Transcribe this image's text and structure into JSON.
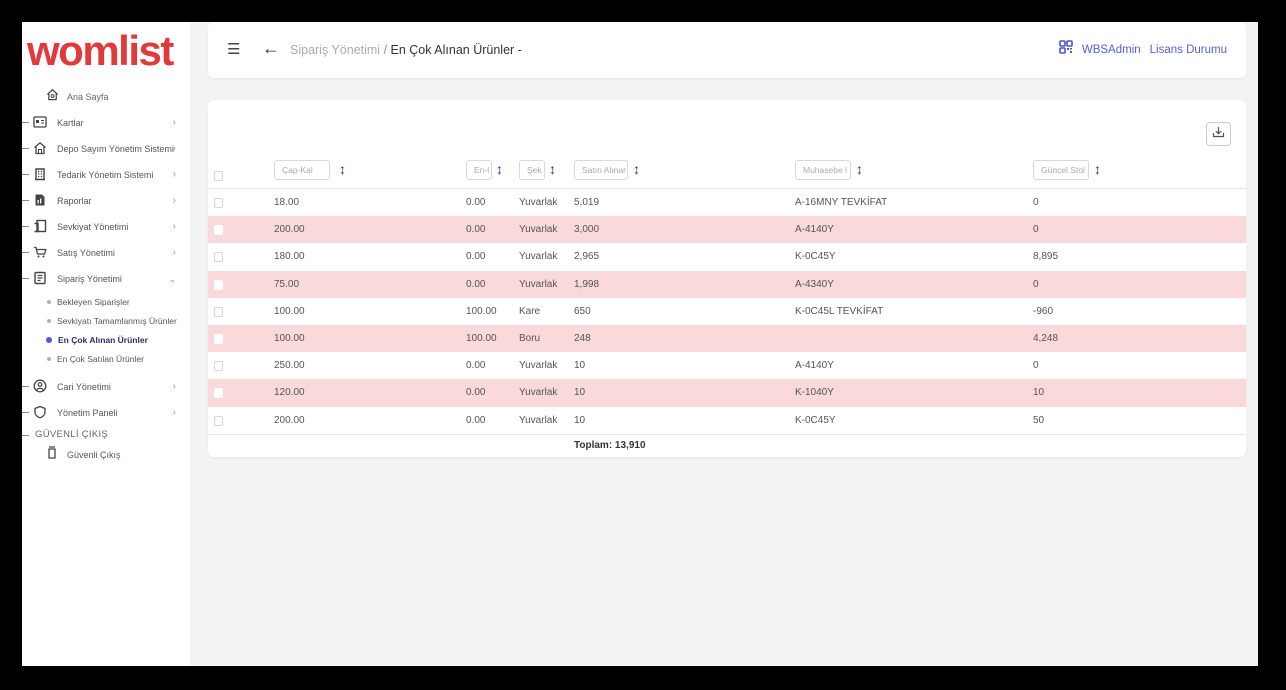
{
  "app": {
    "logo": "womlist",
    "accent": "#e23a3a",
    "link_color": "#5560d8"
  },
  "sidebar": {
    "home_label": "Ana Sayfa",
    "items": [
      {
        "label": "Kartlar",
        "icon": "card-icon"
      },
      {
        "label": "Depo Sayım Yönetim Sistemi",
        "icon": "warehouse-icon"
      },
      {
        "label": "Tedarik Yönetim Sistemi",
        "icon": "building-icon"
      },
      {
        "label": "Raporlar",
        "icon": "report-icon"
      },
      {
        "label": "Sevkiyat Yönetimi",
        "icon": "shipment-icon"
      },
      {
        "label": "Satış Yönetimi",
        "icon": "cart-icon"
      },
      {
        "label": "Sipariş Yönetimi",
        "icon": "order-icon"
      }
    ],
    "sub_items": [
      {
        "label": "Bekleyen Siparişler",
        "active": false
      },
      {
        "label": "Sevkiyatı Tamamlanmış Ürünler",
        "active": false
      },
      {
        "label": "En Çok Alınan Ürünler",
        "active": true
      },
      {
        "label": "En Çok Satılan Ürünler",
        "active": false
      }
    ],
    "items_after": [
      {
        "label": "Cari Yönetimi",
        "icon": "account-icon"
      },
      {
        "label": "Yönetim Paneli",
        "icon": "shield-icon"
      }
    ],
    "section_label": "GÜVENLİ ÇIKIŞ",
    "logout_label": "Güvenli Çıkış"
  },
  "header": {
    "breadcrumb_parent": "Sipariş Yönetimi",
    "breadcrumb_sep": " / ",
    "breadcrumb_current": "En Çok Alınan Ürünler -",
    "user": "WBSAdmin",
    "license": "Lisans Durumu"
  },
  "table": {
    "filters": {
      "cap": "Çap-Kal",
      "en": "En-l",
      "sek": "Şek",
      "satin": "Satın Alınar",
      "muh": "Muhasebe l",
      "stok": "Güncel Stol"
    },
    "rows": [
      {
        "cap": "18.00",
        "en": "0.00",
        "sek": "Yuvarlak",
        "satin": "5,019",
        "muh": "A-16MNY TEVKİFAT",
        "stok": "0",
        "highlight": false
      },
      {
        "cap": "200.00",
        "en": "0.00",
        "sek": "Yuvarlak",
        "satin": "3,000",
        "muh": "A-4140Y",
        "stok": "0",
        "highlight": true
      },
      {
        "cap": "180.00",
        "en": "0.00",
        "sek": "Yuvarlak",
        "satin": "2,965",
        "muh": "K-0C45Y",
        "stok": "8,895",
        "highlight": false
      },
      {
        "cap": "75.00",
        "en": "0.00",
        "sek": "Yuvarlak",
        "satin": "1,998",
        "muh": "A-4340Y",
        "stok": "0",
        "highlight": true
      },
      {
        "cap": "100.00",
        "en": "100.00",
        "sek": "Kare",
        "satin": "650",
        "muh": "K-0C45L TEVKİFAT",
        "stok": "-960",
        "highlight": false
      },
      {
        "cap": "100.00",
        "en": "100.00",
        "sek": "Boru",
        "satin": "248",
        "muh": "",
        "stok": "4,248",
        "highlight": true
      },
      {
        "cap": "250.00",
        "en": "0.00",
        "sek": "Yuvarlak",
        "satin": "10",
        "muh": "A-4140Y",
        "stok": "0",
        "highlight": false
      },
      {
        "cap": "120.00",
        "en": "0.00",
        "sek": "Yuvarlak",
        "satin": "10",
        "muh": "K-1040Y",
        "stok": "10",
        "highlight": true
      },
      {
        "cap": "200.00",
        "en": "0.00",
        "sek": "Yuvarlak",
        "satin": "10",
        "muh": "K-0C45Y",
        "stok": "50",
        "highlight": false
      }
    ],
    "total": "Toplam: 13,910"
  }
}
